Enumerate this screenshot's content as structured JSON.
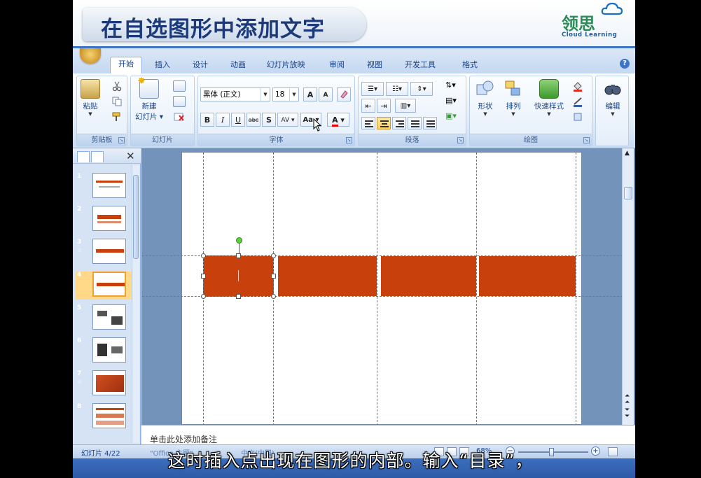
{
  "banner": {
    "title": "在自选图形中添加文字",
    "logo_cn": "领思",
    "logo_en": "Cloud Learning"
  },
  "tabs": [
    {
      "label": "开始",
      "active": true
    },
    {
      "label": "插入"
    },
    {
      "label": "设计"
    },
    {
      "label": "动画"
    },
    {
      "label": "幻灯片放映"
    },
    {
      "label": "审阅"
    },
    {
      "label": "视图"
    },
    {
      "label": "开发工具"
    },
    {
      "label": "格式"
    }
  ],
  "ribbon": {
    "clipboard": {
      "label": "剪贴板",
      "paste": "粘贴"
    },
    "slides": {
      "label": "幻灯片",
      "new_slide_1": "新建",
      "new_slide_2": "幻灯片"
    },
    "font": {
      "label": "字体",
      "font_name": "黑体 (正文)",
      "font_size": "18",
      "bold": "B",
      "italic": "I",
      "underline": "U",
      "strike": "abc",
      "shadow": "S",
      "spacing": "AV",
      "case": "Aa",
      "color": "A",
      "grow": "A",
      "shrink": "A"
    },
    "paragraph": {
      "label": "段落"
    },
    "drawing": {
      "label": "绘图",
      "shapes": "形状",
      "arrange": "排列",
      "quick_styles": "快速样式"
    },
    "editing": {
      "label": "编辑"
    }
  },
  "slides_panel": {
    "thumbs": [
      {
        "num": "1"
      },
      {
        "num": "2"
      },
      {
        "num": "3",
        "sub": "☆"
      },
      {
        "num": "4",
        "selected": true
      },
      {
        "num": "5"
      },
      {
        "num": "6"
      },
      {
        "num": "7",
        "sub": "☆"
      },
      {
        "num": "8"
      }
    ]
  },
  "notes": {
    "placeholder": "单击此处添加备注"
  },
  "status": {
    "slide_indicator": "幻灯片 4/22",
    "theme": "\"Office 主题\"",
    "language": "中文(中国)",
    "zoom": "68%"
  },
  "subtitle": "这时插入点出现在图形的内部。输入“目录”，",
  "colors": {
    "shape_fill": "#c8400c",
    "title_text": "#1c3a7a",
    "ribbon_text": "#15428b",
    "logo_green": "#2e8b57"
  }
}
